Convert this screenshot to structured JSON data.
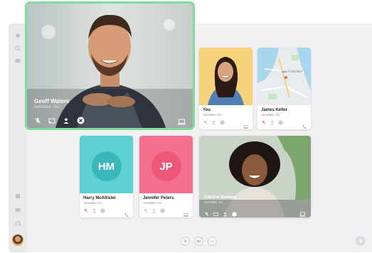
{
  "participants": {
    "featured": {
      "name": "Geoff Waters",
      "company": "Aerolabs, Inc."
    },
    "you": {
      "name": "You",
      "company": "Aerolabs, Inc."
    },
    "james": {
      "name": "James Keller",
      "company": "Aerolabs, Inc."
    },
    "harry": {
      "name": "Harry McAllister",
      "company": "Aerolabs, Inc.",
      "initials": "HM"
    },
    "jennifer": {
      "name": "Jennifer Peters",
      "company": "Aerolabs, Inc.",
      "initials": "JP"
    },
    "adeline": {
      "name": "Adeline Bowers",
      "company": "Aerolabs, Inc."
    }
  },
  "map": {
    "city_label": "San Francisco"
  },
  "colors": {
    "featured_border": "#7fdc9a",
    "you_bg": "#f6d27a",
    "harry_bg": "#5fd0d3",
    "jennifer_bg": "#f4708d",
    "end_call": "#ffffff"
  },
  "icons": [
    "mic-off-icon",
    "cast-icon",
    "person-icon",
    "close-icon",
    "laptop-icon",
    "phone-icon",
    "chat-icon",
    "settings-icon",
    "video-icon"
  ]
}
